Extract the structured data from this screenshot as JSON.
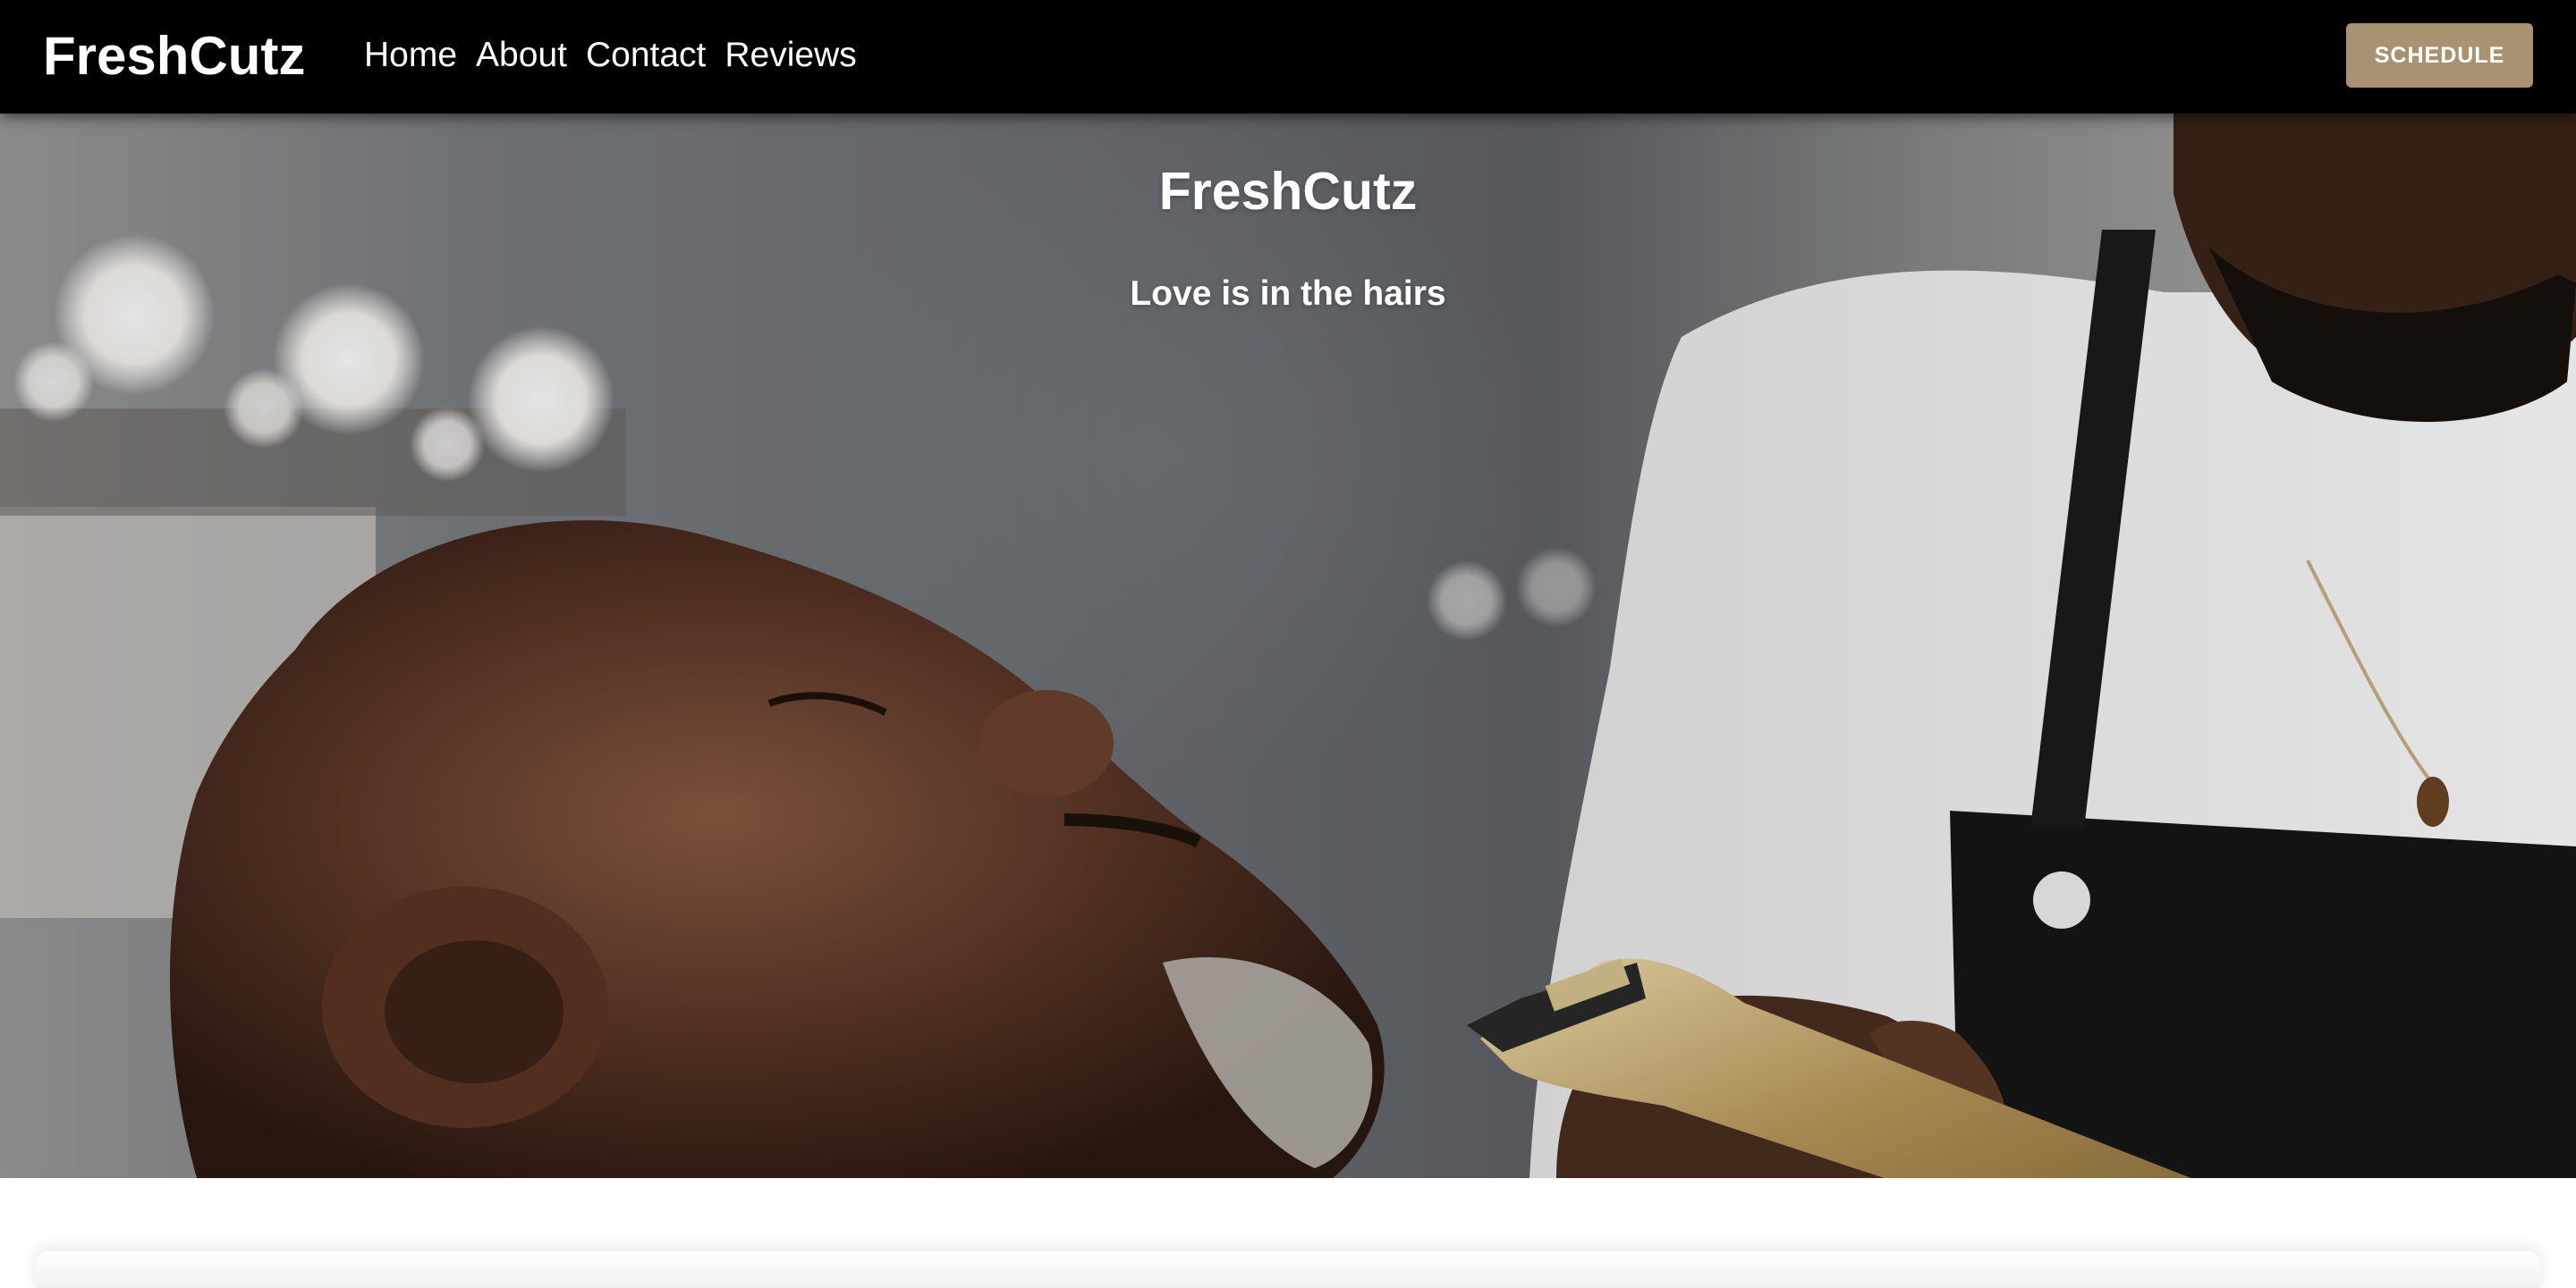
{
  "navbar": {
    "brand": "FreshCutz",
    "links": [
      "Home",
      "About",
      "Contact",
      "Reviews"
    ],
    "schedule_label": "SCHEDULE"
  },
  "hero": {
    "title": "FreshCutz",
    "tagline": "Love is in the hairs"
  },
  "colors": {
    "navbar_bg": "#000000",
    "accent": "#a99272",
    "text": "#ffffff"
  }
}
